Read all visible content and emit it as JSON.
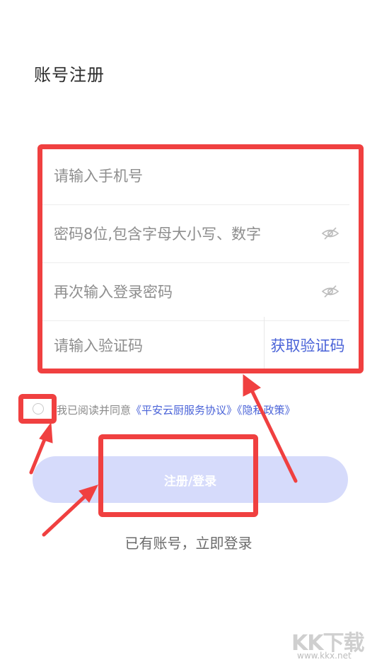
{
  "page": {
    "title": "账号注册"
  },
  "form": {
    "phone_placeholder": "请输入手机号",
    "password_placeholder": "密码8位,包含字母大小写、数字",
    "confirm_placeholder": "再次输入登录密码",
    "code_placeholder": "请输入验证码",
    "get_code_label": "获取验证码"
  },
  "agreement": {
    "prefix": "我已阅读并同意",
    "service_link": "《平安云厨服务协议》",
    "privacy_link": "《隐私政策》",
    "checked": false
  },
  "actions": {
    "submit_label": "注册/登录",
    "login_link": "已有账号，立即登录"
  },
  "watermark": {
    "logo": "KK下载",
    "url": "www.kkx.net"
  },
  "colors": {
    "accent": "#4a63d8",
    "button_disabled": "#d6dbfb",
    "annotation": "#f04040"
  }
}
